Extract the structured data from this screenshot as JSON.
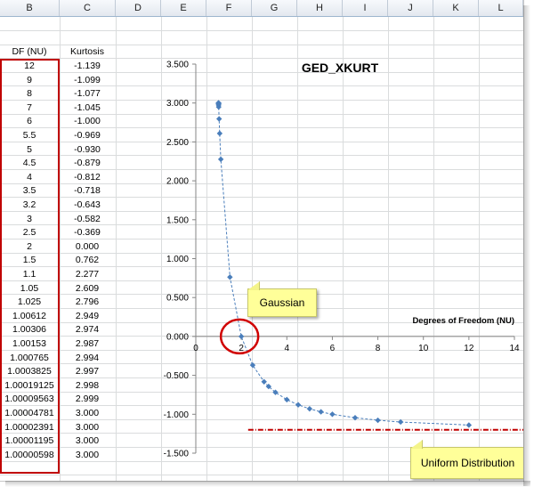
{
  "columns": [
    "B",
    "C",
    "D",
    "E",
    "F",
    "G",
    "H",
    "I",
    "J",
    "K",
    "L"
  ],
  "table": {
    "header_df": "DF (NU)",
    "header_kurtosis": "Kurtosis",
    "rows": [
      {
        "df": "12",
        "kurtosis": "-1.139"
      },
      {
        "df": "9",
        "kurtosis": "-1.099"
      },
      {
        "df": "8",
        "kurtosis": "-1.077"
      },
      {
        "df": "7",
        "kurtosis": "-1.045"
      },
      {
        "df": "6",
        "kurtosis": "-1.000"
      },
      {
        "df": "5.5",
        "kurtosis": "-0.969"
      },
      {
        "df": "5",
        "kurtosis": "-0.930"
      },
      {
        "df": "4.5",
        "kurtosis": "-0.879"
      },
      {
        "df": "4",
        "kurtosis": "-0.812"
      },
      {
        "df": "3.5",
        "kurtosis": "-0.718"
      },
      {
        "df": "3.2",
        "kurtosis": "-0.643"
      },
      {
        "df": "3",
        "kurtosis": "-0.582"
      },
      {
        "df": "2.5",
        "kurtosis": "-0.369"
      },
      {
        "df": "2",
        "kurtosis": "0.000"
      },
      {
        "df": "1.5",
        "kurtosis": "0.762"
      },
      {
        "df": "1.1",
        "kurtosis": "2.277"
      },
      {
        "df": "1.05",
        "kurtosis": "2.609"
      },
      {
        "df": "1.025",
        "kurtosis": "2.796"
      },
      {
        "df": "1.00612",
        "kurtosis": "2.949"
      },
      {
        "df": "1.00306",
        "kurtosis": "2.974"
      },
      {
        "df": "1.00153",
        "kurtosis": "2.987"
      },
      {
        "df": "1.000765",
        "kurtosis": "2.994"
      },
      {
        "df": "1.0003825",
        "kurtosis": "2.997"
      },
      {
        "df": "1.00019125",
        "kurtosis": "2.998"
      },
      {
        "df": "1.00009563",
        "kurtosis": "2.999"
      },
      {
        "df": "1.00004781",
        "kurtosis": "3.000"
      },
      {
        "df": "1.00002391",
        "kurtosis": "3.000"
      },
      {
        "df": "1.00001195",
        "kurtosis": "3.000"
      },
      {
        "df": "1.00000598",
        "kurtosis": "3.000"
      }
    ]
  },
  "chart_data": {
    "type": "scatter",
    "title": "GED_XKURT",
    "xlabel": "Degrees of Freedom (NU)",
    "ylabel": "",
    "xlim": [
      0,
      14
    ],
    "ylim": [
      -1.5,
      3.5
    ],
    "x_ticks": [
      "0",
      "2",
      "4",
      "6",
      "8",
      "10",
      "12",
      "14"
    ],
    "y_ticks": [
      "3.500",
      "3.000",
      "2.500",
      "2.000",
      "1.500",
      "1.000",
      "0.500",
      "0.000",
      "-0.500",
      "-1.000",
      "-1.500"
    ],
    "series": [
      {
        "x": [
          12,
          9,
          8,
          7,
          6,
          5.5,
          5,
          4.5,
          4,
          3.5,
          3.2,
          3,
          2.5,
          2,
          1.5,
          1.1,
          1.05,
          1.025,
          1.00612,
          1.00306,
          1.00153,
          1.000765,
          1.0003825,
          1.00019125,
          1.00009563,
          1.00004781,
          1.00002391,
          1.00001195,
          1.00000598
        ],
        "y": [
          -1.139,
          -1.099,
          -1.077,
          -1.045,
          -1.0,
          -0.969,
          -0.93,
          -0.879,
          -0.812,
          -0.718,
          -0.643,
          -0.582,
          -0.369,
          0.0,
          0.762,
          2.277,
          2.609,
          2.796,
          2.949,
          2.974,
          2.987,
          2.994,
          2.997,
          2.998,
          2.999,
          3.0,
          3.0,
          3.0,
          3.0
        ]
      }
    ],
    "reference_line_y": -1.2,
    "marker_color": "#4a7ebb",
    "reference_line_color": "#c00000",
    "highlight_color": "#d00000",
    "grid": false
  },
  "callouts": {
    "gaussian": "Gaussian",
    "uniform": "Uniform Distribution"
  }
}
